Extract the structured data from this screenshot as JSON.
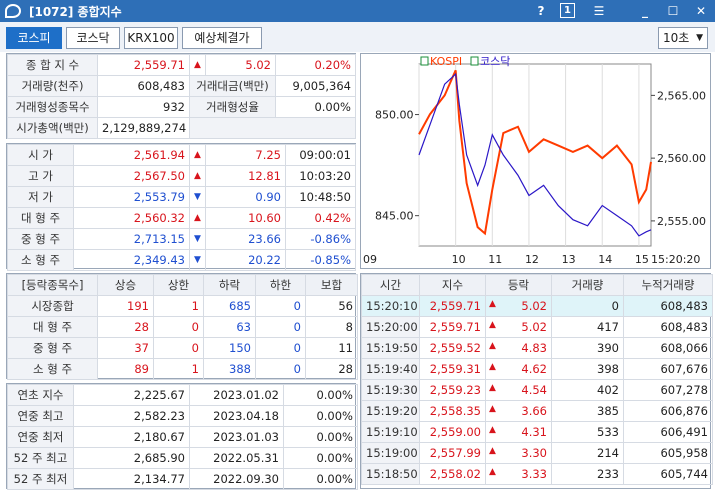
{
  "window": {
    "title": "[1072] 종합지수",
    "help": "?",
    "num": "1"
  },
  "tabs": [
    "코스피",
    "코스닥",
    "KRX100",
    "예상체결가"
  ],
  "interval": "10초",
  "summary": {
    "rows": [
      {
        "l1": "종 합 지 수",
        "v1": "2,559.71",
        "arrow": "▲",
        "chg": "5.02",
        "pct": "0.20%"
      },
      {
        "l1": "거래량(천주)",
        "v1": "608,483",
        "l2": "거래대금(백만)",
        "v2": "9,005,364"
      },
      {
        "l1": "거래형성종목수",
        "v1": "932",
        "l2": "거래형성율",
        "v2": "0.00%"
      },
      {
        "l1": "시가총액(백만)",
        "v1": "2,129,889,274"
      }
    ]
  },
  "prices": [
    {
      "l": "시 가",
      "v": "2,561.94",
      "a": "▲",
      "c": "7.25",
      "t": "09:00:01",
      "col": "red"
    },
    {
      "l": "고 가",
      "v": "2,567.50",
      "a": "▲",
      "c": "12.81",
      "t": "10:03:20",
      "col": "red"
    },
    {
      "l": "저 가",
      "v": "2,553.79",
      "a": "▼",
      "c": "0.90",
      "t": "10:48:50",
      "col": "blue"
    },
    {
      "l": "대 형 주",
      "v": "2,560.32",
      "a": "▲",
      "c": "10.60",
      "t": "0.42%",
      "col": "red"
    },
    {
      "l": "중 형 주",
      "v": "2,713.15",
      "a": "▼",
      "c": "23.66",
      "t": "-0.86%",
      "col": "blue"
    },
    {
      "l": "소 형 주",
      "v": "2,349.43",
      "a": "▼",
      "c": "20.22",
      "t": "-0.85%",
      "col": "blue"
    }
  ],
  "breadth": {
    "headers": [
      "[등락종목수]",
      "상승",
      "상한",
      "하락",
      "하한",
      "보합"
    ],
    "rows": [
      [
        "시장종합",
        "191",
        "1",
        "685",
        "0",
        "56"
      ],
      [
        "대 형 주",
        "28",
        "0",
        "63",
        "0",
        "8"
      ],
      [
        "중 형 주",
        "37",
        "0",
        "150",
        "0",
        "11"
      ],
      [
        "소 형 주",
        "89",
        "1",
        "388",
        "0",
        "28"
      ]
    ]
  },
  "hist": [
    [
      "연초 지수",
      "2,225.67",
      "2023.01.02",
      "0.00%"
    ],
    [
      "연중 최고",
      "2,582.23",
      "2023.04.18",
      "0.00%"
    ],
    [
      "연중 최저",
      "2,180.67",
      "2023.01.03",
      "0.00%"
    ],
    [
      "52 주 최고",
      "2,685.90",
      "2022.05.31",
      "0.00%"
    ],
    [
      "52 주 최저",
      "2,134.77",
      "2022.09.30",
      "0.00%"
    ]
  ],
  "ticks": {
    "headers": [
      "시간",
      "지수",
      "등락",
      "거래량",
      "누적거래량"
    ],
    "rows": [
      [
        "15:20:10",
        "2,559.71",
        "▲",
        "5.02",
        "0",
        "608,483"
      ],
      [
        "15:20:00",
        "2,559.71",
        "▲",
        "5.02",
        "417",
        "608,483"
      ],
      [
        "15:19:50",
        "2,559.52",
        "▲",
        "4.83",
        "390",
        "608,066"
      ],
      [
        "15:19:40",
        "2,559.31",
        "▲",
        "4.62",
        "398",
        "607,676"
      ],
      [
        "15:19:30",
        "2,559.23",
        "▲",
        "4.54",
        "402",
        "607,278"
      ],
      [
        "15:19:20",
        "2,558.35",
        "▲",
        "3.66",
        "385",
        "606,876"
      ],
      [
        "15:19:10",
        "2,559.00",
        "▲",
        "4.31",
        "533",
        "606,491"
      ],
      [
        "15:19:00",
        "2,557.99",
        "▲",
        "3.30",
        "214",
        "605,958"
      ],
      [
        "15:18:50",
        "2,558.02",
        "▲",
        "3.33",
        "233",
        "605,744"
      ]
    ]
  },
  "chart_data": {
    "type": "line",
    "legend": [
      "KOSPI",
      "코스닥"
    ],
    "x_ticks": [
      "09",
      "10",
      "11",
      "12",
      "13",
      "14",
      "15"
    ],
    "time_label": "15:20:20",
    "left_ticks": [
      "850.00",
      "845.00"
    ],
    "right_ticks": [
      "2,565.00",
      "2,560.00",
      "2,555.00"
    ],
    "series": [
      {
        "name": "KOSPI",
        "color": "#ff3b00",
        "axis": "right",
        "points": [
          [
            9.0,
            2561.9
          ],
          [
            9.3,
            2563.5
          ],
          [
            9.7,
            2565.0
          ],
          [
            10.0,
            2567.0
          ],
          [
            10.1,
            2563.0
          ],
          [
            10.3,
            2558.0
          ],
          [
            10.6,
            2554.5
          ],
          [
            10.8,
            2554.0
          ],
          [
            11.0,
            2557.5
          ],
          [
            11.3,
            2562.0
          ],
          [
            11.7,
            2562.5
          ],
          [
            12.0,
            2560.5
          ],
          [
            12.4,
            2561.5
          ],
          [
            12.8,
            2561.0
          ],
          [
            13.2,
            2560.5
          ],
          [
            13.6,
            2561.0
          ],
          [
            14.0,
            2560.0
          ],
          [
            14.4,
            2561.0
          ],
          [
            14.8,
            2559.5
          ],
          [
            15.0,
            2556.5
          ],
          [
            15.2,
            2557.5
          ],
          [
            15.33,
            2559.7
          ]
        ]
      },
      {
        "name": "코스닥",
        "color": "#2b17c7",
        "axis": "left",
        "points": [
          [
            9.0,
            848.0
          ],
          [
            9.3,
            849.5
          ],
          [
            9.7,
            851.5
          ],
          [
            10.0,
            852.0
          ],
          [
            10.1,
            850.5
          ],
          [
            10.3,
            848.0
          ],
          [
            10.6,
            846.5
          ],
          [
            10.8,
            847.5
          ],
          [
            11.0,
            849.0
          ],
          [
            11.3,
            848.0
          ],
          [
            11.7,
            847.0
          ],
          [
            12.0,
            846.0
          ],
          [
            12.4,
            846.5
          ],
          [
            12.8,
            845.5
          ],
          [
            13.2,
            844.8
          ],
          [
            13.6,
            844.5
          ],
          [
            14.0,
            845.5
          ],
          [
            14.4,
            845.0
          ],
          [
            14.8,
            844.5
          ],
          [
            15.0,
            844.0
          ],
          [
            15.2,
            844.2
          ],
          [
            15.33,
            844.3
          ]
        ]
      }
    ]
  }
}
